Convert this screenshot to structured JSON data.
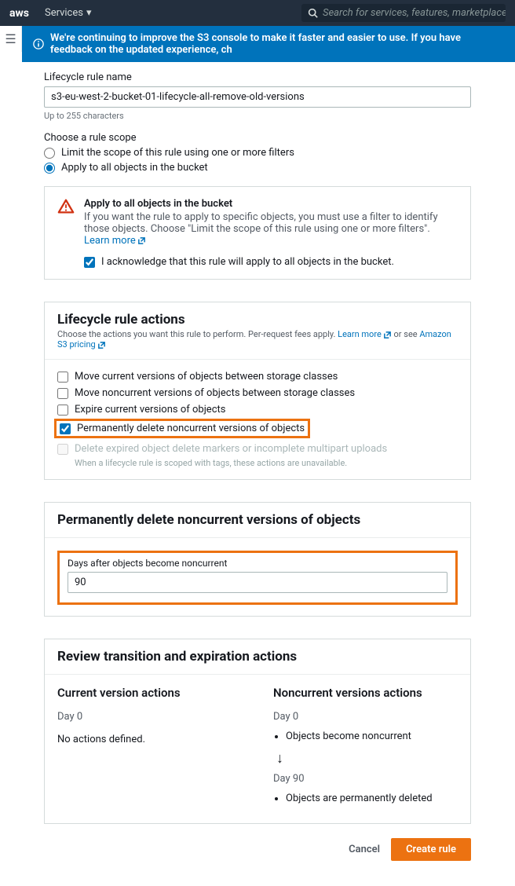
{
  "topbar": {
    "services_label": "Services",
    "search_placeholder": "Search for services, features, marketplace products, and d"
  },
  "banner": {
    "text": "We're continuing to improve the S3 console to make it faster and easier to use. If you have feedback on the updated experience, ch"
  },
  "form": {
    "rule_name_label": "Lifecycle rule name",
    "rule_name_value": "s3-eu-west-2-bucket-01-lifecycle-all-remove-old-versions",
    "rule_name_hint": "Up to 255 characters",
    "scope_label": "Choose a rule scope",
    "scope_opt_limit": "Limit the scope of this rule using one or more filters",
    "scope_opt_all": "Apply to all objects in the bucket"
  },
  "alert": {
    "title": "Apply to all objects in the bucket",
    "body": "If you want the rule to apply to specific objects, you must use a filter to identify those objects. Choose \"Limit the scope of this rule using one or more filters\". ",
    "learn_more": "Learn more",
    "ack": "I acknowledge that this rule will apply to all objects in the bucket."
  },
  "actions": {
    "title": "Lifecycle rule actions",
    "sub": "Choose the actions you want this rule to perform. Per-request fees apply. ",
    "learn_more": "Learn more",
    "or_see": " or see ",
    "s3_pricing": "Amazon S3 pricing",
    "items": [
      "Move current versions of objects between storage classes",
      "Move noncurrent versions of objects between storage classes",
      "Expire current versions of objects",
      "Permanently delete noncurrent versions of objects",
      "Delete expired object delete markers or incomplete multipart uploads"
    ],
    "disabled_sub": "When a lifecycle rule is scoped with tags, these actions are unavailable."
  },
  "perm_delete": {
    "title": "Permanently delete noncurrent versions of objects",
    "days_label": "Days after objects become noncurrent",
    "days_value": "90"
  },
  "review": {
    "title": "Review transition and expiration actions",
    "current_title": "Current version actions",
    "current_day0": "Day 0",
    "current_none": "No actions defined.",
    "noncurrent_title": "Noncurrent versions actions",
    "noncurrent_day0": "Day 0",
    "noncurrent_event0": "Objects become noncurrent",
    "noncurrent_day90": "Day 90",
    "noncurrent_event90": "Objects are permanently deleted"
  },
  "footer": {
    "cancel": "Cancel",
    "create": "Create rule"
  }
}
